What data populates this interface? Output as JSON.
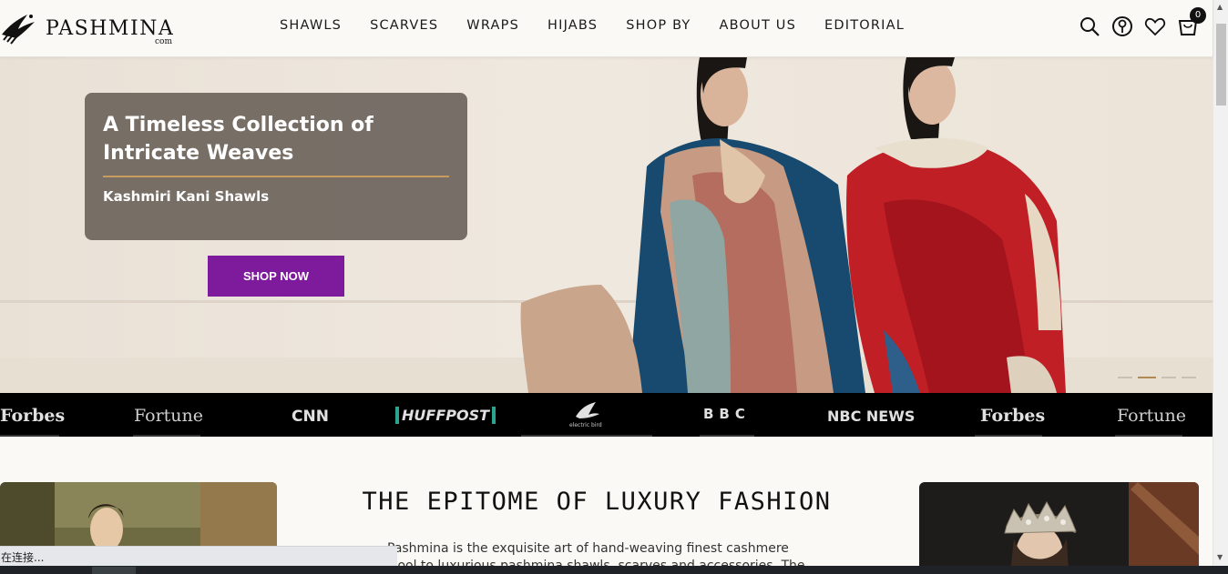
{
  "header": {
    "logo_text": "PASHMINA",
    "logo_sub": "com",
    "nav": [
      "SHAWLS",
      "SCARVES",
      "WRAPS",
      "HIJABS",
      "SHOP BY",
      "ABOUT US",
      "EDITORIAL"
    ],
    "icons": [
      "search-icon",
      "account-icon",
      "wishlist-heart-icon",
      "cart-icon"
    ],
    "cart_count": "0"
  },
  "hero": {
    "title": "A Timeless Collection of Intricate Weaves",
    "subtitle": "Kashmiri Kani Shawls",
    "cta": "SHOP NOW",
    "slides": 4,
    "active_slide": 2
  },
  "press": [
    "Forbes",
    "Fortune",
    "CNN",
    "HUFFPOST",
    "electric bird",
    "BBC",
    "NBC NEWS",
    "Forbes",
    "Fortune"
  ],
  "content": {
    "heading": "THE EPITOME OF LUXURY FASHION",
    "paragraph": "Pashmina is the exquisite art of hand-weaving finest cashmere wool to luxurious pashmina shawls, scarves and accessories. The heavenly"
  },
  "status": {
    "text": "在连接..."
  },
  "colors": {
    "accent": "#7e1b9c",
    "gold_rule": "#c79c5e",
    "caption_bg": "#6c645c"
  }
}
